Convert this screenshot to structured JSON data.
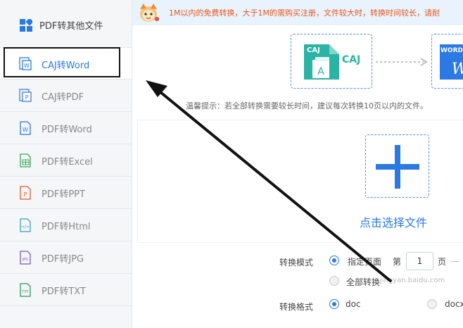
{
  "sidebar": {
    "header": "PDF转其他文件",
    "items": [
      {
        "label": "CAJ转Word",
        "icon": "caj-word-icon",
        "color": "#2b79e3"
      },
      {
        "label": "CAJ转PDF",
        "icon": "caj-pdf-icon",
        "color": "#3a7fd8"
      },
      {
        "label": "PDF转Word",
        "icon": "word-icon",
        "color": "#2b79e3"
      },
      {
        "label": "PDF转Excel",
        "icon": "excel-icon",
        "color": "#3aa55a"
      },
      {
        "label": "PDF转PPT",
        "icon": "ppt-icon",
        "color": "#e0612a"
      },
      {
        "label": "PDF转Html",
        "icon": "html-icon",
        "color": "#39a0c8"
      },
      {
        "label": "PDF转JPG",
        "icon": "jpg-icon",
        "color": "#7a5bb8"
      },
      {
        "label": "PDF转TXT",
        "icon": "txt-icon",
        "color": "#2f9a5a"
      }
    ]
  },
  "banner": {
    "text": "1M以内的免费转换，大于1M的需购买注册，文件较大时，转换时间较长，请耐"
  },
  "conversion": {
    "source_badge": "CAJ",
    "source_letter": "A",
    "source_name": "CAJ",
    "target_badge": "WORD",
    "target_letter": "W"
  },
  "hint": "温馨提示：若全部转换需要较长时间，建议每次转换10页以内的文件。",
  "upload": {
    "label": "点击选择文件"
  },
  "options": {
    "mode_label": "转换模式",
    "mode_specified": "指定页面",
    "page_prefix": "第",
    "page_value": "1",
    "page_suffix": "页",
    "page_dash": "一",
    "mode_all": "全部转换",
    "format_label": "转换格式",
    "format_doc": "doc",
    "format_docx": "docx"
  },
  "watermark": "jingyan.baidu.com",
  "colors": {
    "accent": "#2b79e3",
    "banner_text": "#e8561c",
    "caj_teal": "#2bb3a3"
  }
}
